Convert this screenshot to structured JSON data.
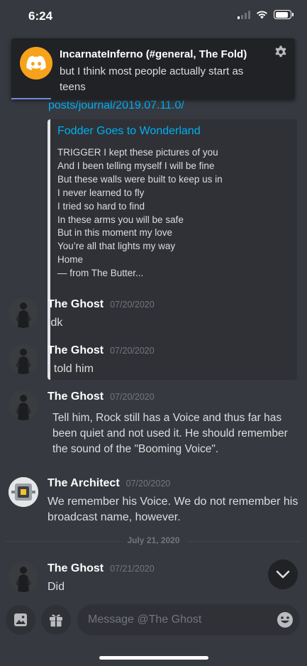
{
  "status_bar": {
    "time": "6:24"
  },
  "notification": {
    "title": "IncarnateInferno (#general, The Fold)",
    "body": "but I think most people actually start as teens",
    "icon": "discord-logo-icon",
    "accent_color": "#f7a21b"
  },
  "chat": {
    "partial_link": "posts/journal/2019.07.11.0/",
    "embed": {
      "title": "Fodder Goes to Wonderland",
      "description_lines": [
        "TRIGGER  I kept these pictures of you",
        "And I been telling myself I will be fine",
        "But these walls were built to keep us in",
        "I never learned to fly",
        "I tried so hard to find",
        "In these arms you will be safe",
        "But in this moment my love",
        "You’re all that lights my way",
        "Home",
        "— from The Butter..."
      ]
    },
    "messages": [
      {
        "author": "The Ghost",
        "timestamp": "07/20/2020",
        "text": "Idk"
      },
      {
        "author": "The Ghost",
        "timestamp": "07/20/2020",
        "text": "I told him"
      },
      {
        "author": "The Ghost",
        "timestamp": "07/20/2020",
        "text": "Tell him, Rock still has a Voice and thus far has been quiet and not used it. He should remember the sound of the \"Booming Voice\"."
      },
      {
        "author": "The Architect",
        "timestamp": "07/20/2020",
        "text": "We remember his Voice. We do not remember his broadcast name, however."
      },
      {
        "author": "The Ghost",
        "timestamp": "07/21/2020",
        "text": "Did"
      }
    ],
    "date_divider": "July 21, 2020"
  },
  "composer": {
    "placeholder": "Message @The Ghost"
  },
  "colors": {
    "background": "#36393f",
    "link": "#00b0f4",
    "muted": "#72767d"
  }
}
